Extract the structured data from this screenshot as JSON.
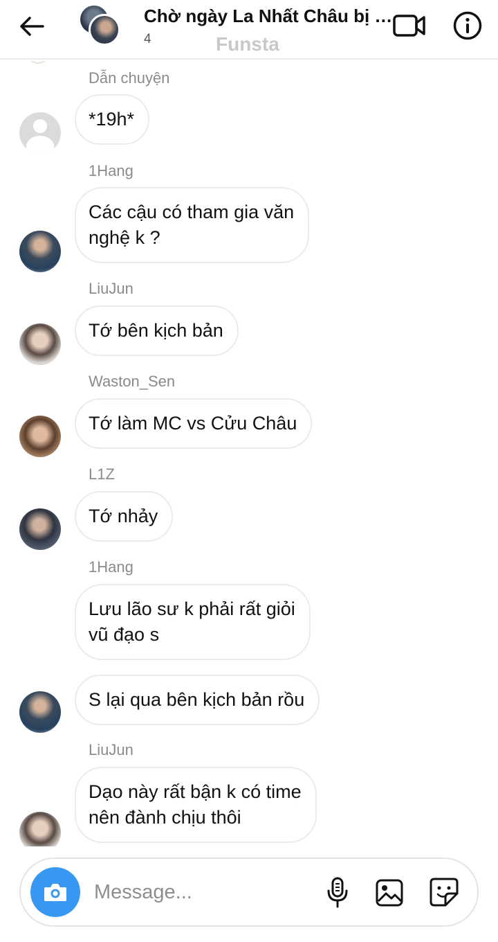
{
  "header": {
    "title": "Chờ ngày La Nhất Châu bị n...",
    "member_count": "4",
    "watermark": "Funsta",
    "icons": {
      "back": "arrow-left-icon",
      "video": "video-camera-icon",
      "info": "info-circle-icon"
    }
  },
  "messages": [
    {
      "sender": "Dẫn chuyện",
      "text": "*19h*",
      "avatar": "default-profile"
    },
    {
      "sender": "1Hang",
      "text": "Các cậu có tham gia văn\nnghệ k ?",
      "avatar": "1hang"
    },
    {
      "sender": "LiuJun",
      "text": "Tớ bên kịch bản",
      "avatar": "liujun"
    },
    {
      "sender": "Waston_Sen",
      "text": "Tớ làm MC vs Cửu Châu",
      "avatar": "waston-sen"
    },
    {
      "sender": "L1Z",
      "text": "Tớ nhảy",
      "avatar": "l1z"
    },
    {
      "sender": "1Hang",
      "text": "Lưu lão sư k phải rất giỏi\nvũ đạo s",
      "avatar": null
    },
    {
      "sender": "",
      "text": "S lại qua bên kịch bản rồu",
      "avatar": "1hang"
    },
    {
      "sender": "LiuJun",
      "text": "Dạo này rất bận k có time\nnên đành chịu thôi",
      "avatar": "liujun"
    }
  ],
  "composer": {
    "placeholder": "Message...",
    "accent_color": "#3897f0",
    "icons": {
      "camera": "camera-icon",
      "mic": "microphone-icon",
      "gallery": "image-gallery-icon",
      "sticker": "sticker-icon"
    }
  }
}
